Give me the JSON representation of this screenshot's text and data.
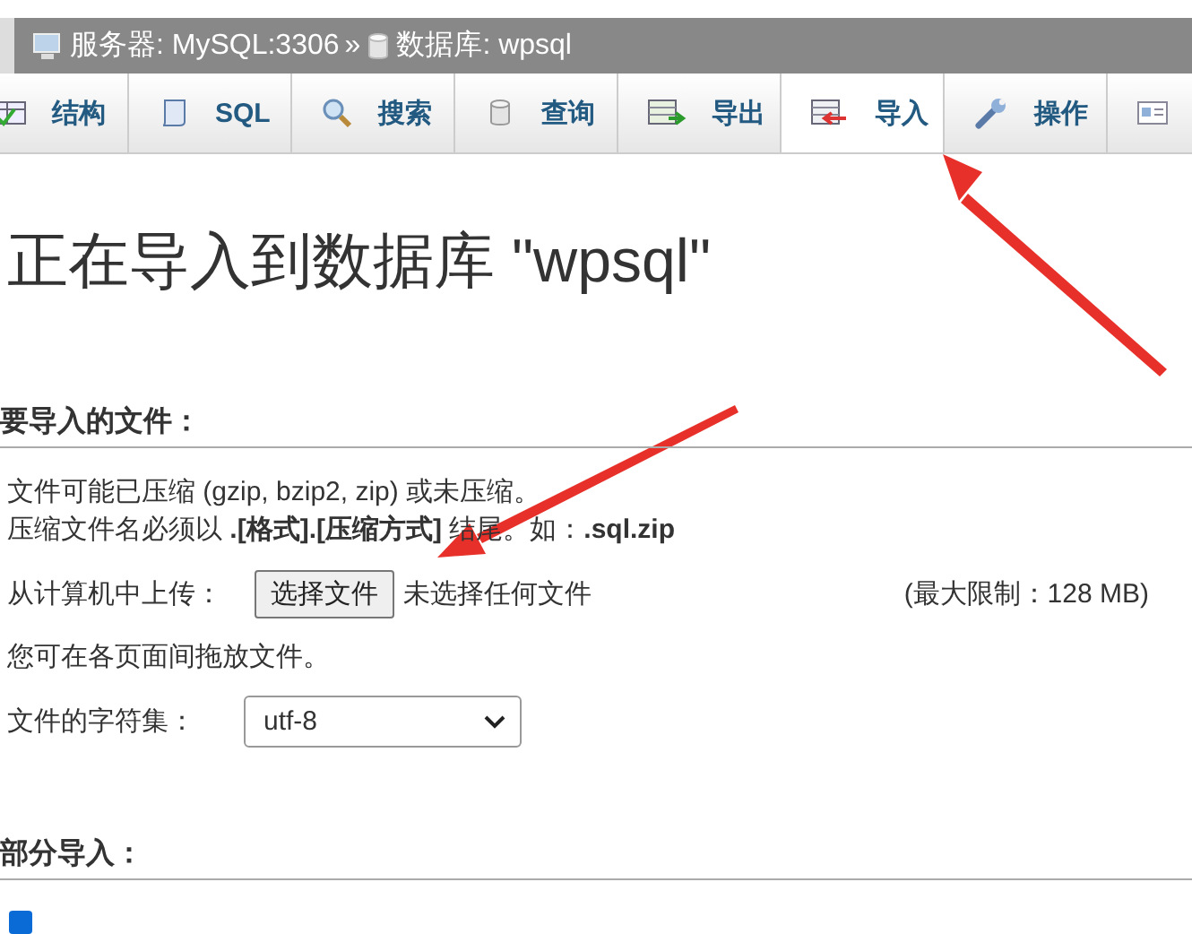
{
  "breadcrumb": [
    {
      "kind": "server",
      "label": "服务器: MySQL:3306"
    },
    {
      "kind": "database",
      "label": "数据库: wpsql"
    }
  ],
  "separator": "»",
  "tabs": [
    {
      "kind": "structure",
      "label": "结构",
      "selected": false
    },
    {
      "kind": "sql",
      "label": "SQL",
      "selected": false
    },
    {
      "kind": "search",
      "label": "搜索",
      "selected": false
    },
    {
      "kind": "query",
      "label": "查询",
      "selected": false
    },
    {
      "kind": "export",
      "label": "导出",
      "selected": false
    },
    {
      "kind": "import",
      "label": "导入",
      "selected": true
    },
    {
      "kind": "operations",
      "label": "操作",
      "selected": false
    },
    {
      "kind": "card",
      "selected": false
    }
  ],
  "title": "正在导入到数据库 \"wpsql\"",
  "file_section": {
    "heading": "要导入的文件：",
    "note_1": "文件可能已压缩 (gzip, bzip2, zip) 或未压缩。",
    "note_2": "压缩文件名必须以 **.[格式].[压缩方式]** 结尾。如：**.sql.zip**",
    "upload_label": "从计算机中上传：",
    "choose_button": "选择文件",
    "no_file": "未选择任何文件",
    "max_size": "(最大限制：128 MB)",
    "drag_hint": "您可在各页面间拖放文件。",
    "charset_label": "文件的字符集：",
    "charset_value": "utf-8"
  },
  "partial_section": {
    "heading": "部分导入：",
    "allow_interrupt": {
      "checked": true
    }
  }
}
